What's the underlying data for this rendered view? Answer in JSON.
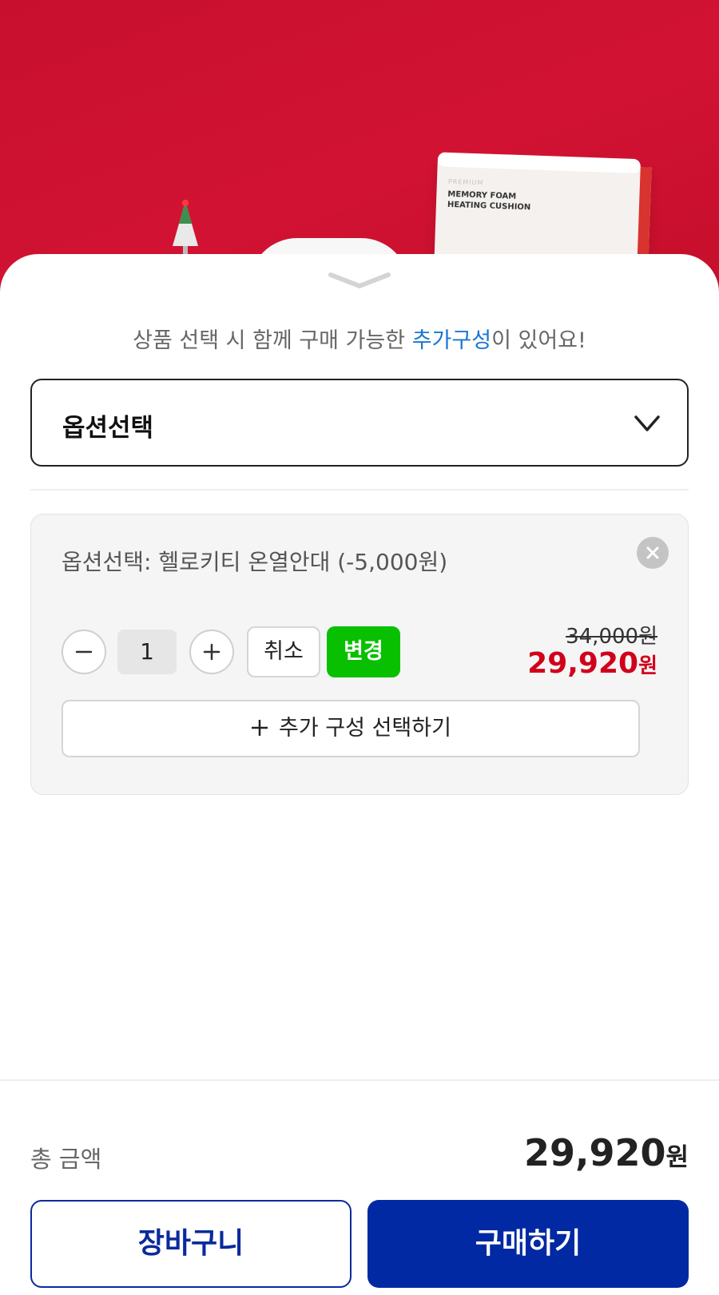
{
  "hero": {
    "box_small_label": "PREMIUM",
    "box_title_line1": "MEMORY FOAM",
    "box_title_line2": "HEATING CUSHION",
    "background_color": "#c8102e"
  },
  "sheet": {
    "handle_icon": "chevron-down-icon",
    "notice": {
      "prefix": "상품 선택 시 함께 구매 가능한 ",
      "highlight": "추가구성",
      "suffix": "이 있어요!",
      "highlight_color": "#1976d2"
    },
    "option_select": {
      "label": "옵션선택",
      "icon": "chevron-down-icon"
    },
    "selected_item": {
      "option_text": "옵션선택: 헬로키티 온열안대 (-5,000원)",
      "remove_icon": "close-icon",
      "minus_icon": "minus-icon",
      "quantity": "1",
      "plus_icon": "plus-icon",
      "cancel_label": "취소",
      "change_label": "변경",
      "change_color": "#08c000",
      "original_price": "34,000원",
      "sale_price_number": "29,920",
      "sale_price_unit": "원",
      "sale_price_color": "#d0021b",
      "add_component_label": "추가 구성 선택하기"
    }
  },
  "footer": {
    "total_label": "총 금액",
    "total_number": "29,920",
    "total_unit": "원",
    "cart_label": "장바구니",
    "buy_label": "구매하기",
    "brand_color": "#0029a3"
  }
}
